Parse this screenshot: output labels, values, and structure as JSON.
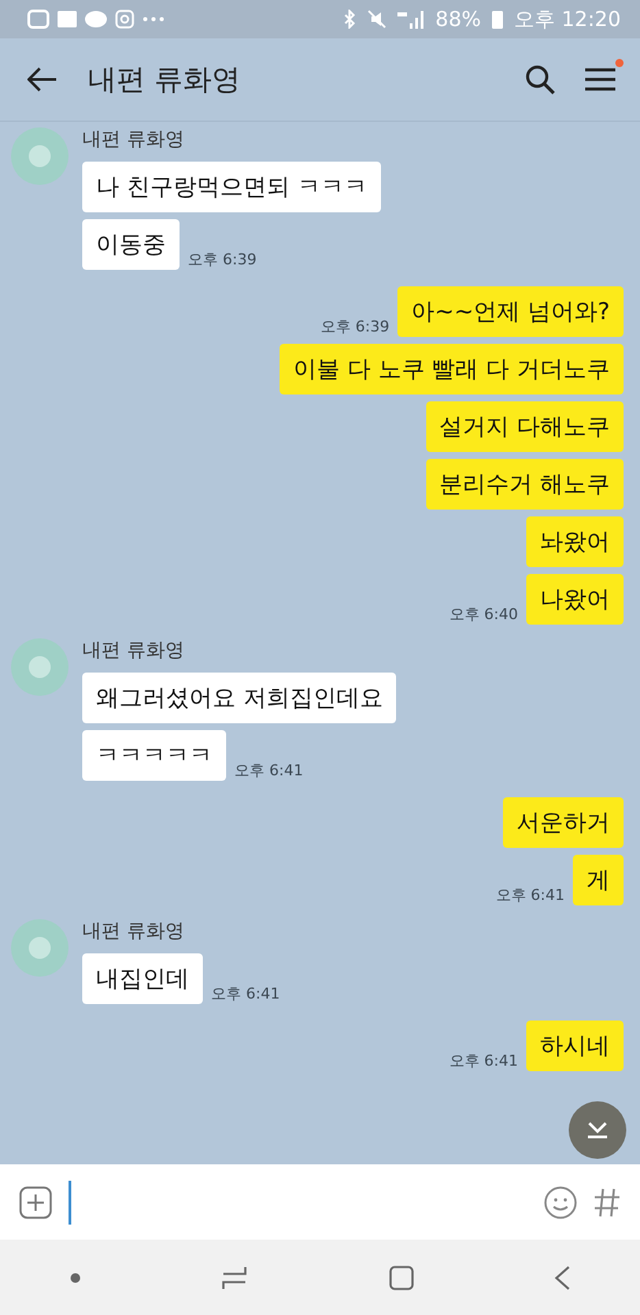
{
  "status_bar": {
    "battery": "88%",
    "time": "오후 12:20"
  },
  "header": {
    "title": "내편 류화영",
    "menu_badge": true
  },
  "messages": [
    {
      "kind": "received",
      "sender": "내편 류화영",
      "bubbles": [
        {
          "text": "나 친구랑먹으면되 ㅋㅋㅋ"
        },
        {
          "text": "이동중",
          "time": "오후 6:39"
        }
      ]
    },
    {
      "kind": "sent",
      "bubbles": [
        {
          "text": "아~~언제 넘어와?",
          "time": "오후 6:39"
        },
        {
          "text": "이불 다 노쿠 빨래 다 거더노쿠"
        },
        {
          "text": "설거지 다해노쿠"
        },
        {
          "text": "분리수거 해노쿠"
        },
        {
          "text": "놔왔어"
        },
        {
          "text": "나왔어",
          "time": "오후 6:40"
        }
      ]
    },
    {
      "kind": "received",
      "sender": "내편 류화영",
      "bubbles": [
        {
          "text": "왜그러셨어요 저희집인데요"
        },
        {
          "text": "ㅋㅋㅋㅋㅋ",
          "time": "오후 6:41"
        }
      ]
    },
    {
      "kind": "sent",
      "bubbles": [
        {
          "text": "서운하거"
        },
        {
          "text": "게",
          "time": "오후 6:41"
        }
      ]
    },
    {
      "kind": "received",
      "sender": "내편 류화영",
      "bubbles": [
        {
          "text": "내집인데",
          "time": "오후 6:41"
        }
      ]
    },
    {
      "kind": "sent",
      "bubbles": [
        {
          "text": "하시네",
          "time": "오후 6:41"
        }
      ]
    }
  ]
}
